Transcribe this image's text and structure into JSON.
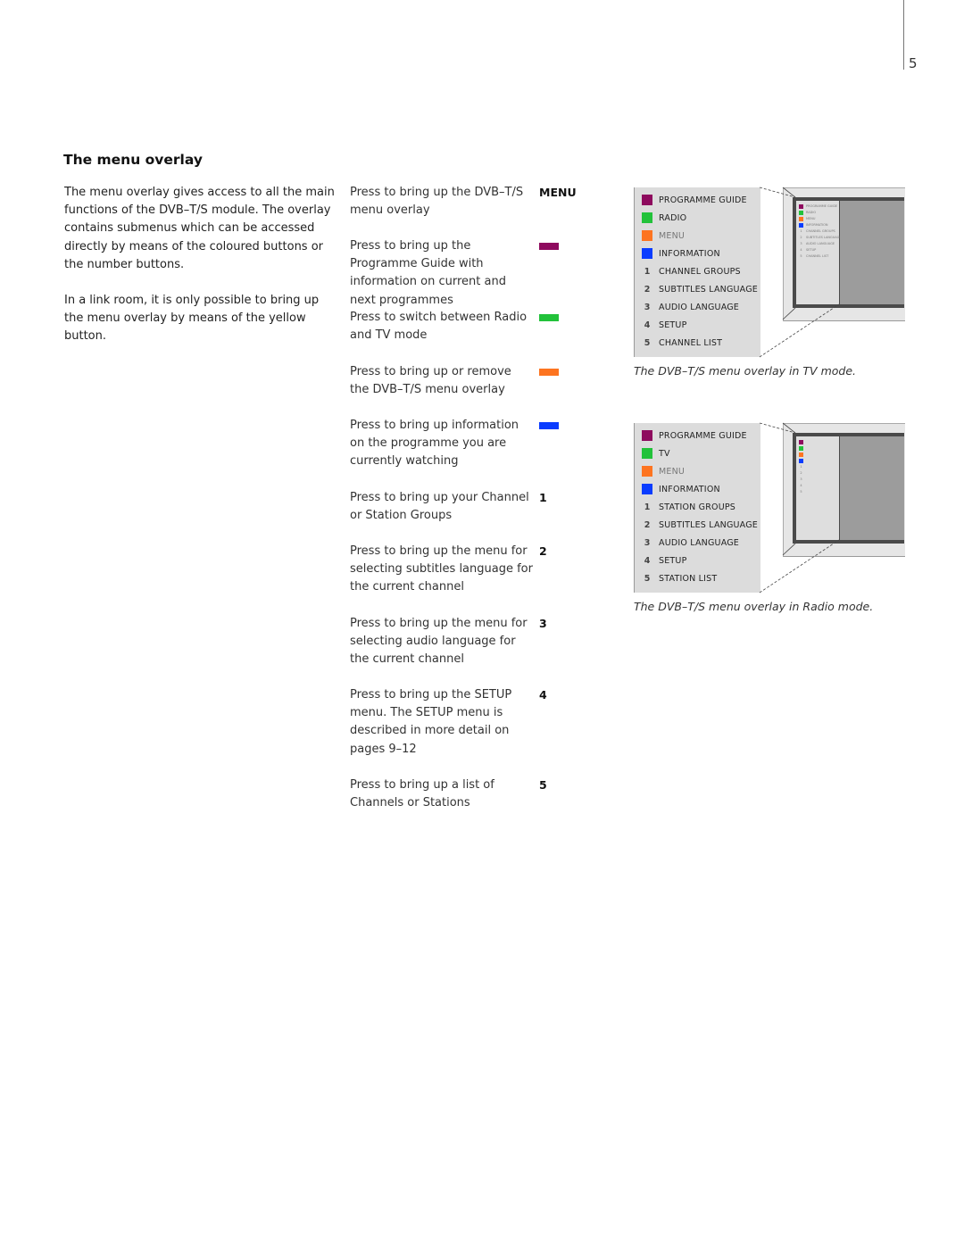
{
  "page": {
    "number": "5"
  },
  "section": {
    "title": "The menu overlay",
    "intro": [
      "The menu overlay gives access to all the main functions of the DVB–T/S module. The overlay contains submenus which can be accessed directly by means of the coloured buttons or the number buttons.",
      "In a link room, it is only possible to bring up the menu overlay by means of the yellow button."
    ]
  },
  "colors": {
    "purple": "#8e0a5e",
    "green": "#22c23a",
    "orange": "#fd7420",
    "blue": "#0a3cff"
  },
  "steps": [
    {
      "text": "Press to bring up the DVB–T/S menu overlay",
      "key": "MENU",
      "key_type": "text"
    },
    {
      "text": "Press to bring up the Programme Guide with information on current and next programmes",
      "key": "purple-button",
      "key_type": "color"
    },
    {
      "text": "Press to switch between Radio and TV mode",
      "key": "green-button",
      "key_type": "color"
    },
    {
      "text": "Press to bring up or remove the DVB–T/S menu overlay",
      "key": "orange-button",
      "key_type": "color"
    },
    {
      "text": "Press to bring up information on the programme you are currently watching",
      "key": "blue-button",
      "key_type": "color"
    },
    {
      "text": "Press to bring up your Channel or Station Groups",
      "key": "1",
      "key_type": "text"
    },
    {
      "text": "Press to bring up the menu for selecting subtitles language for the current channel",
      "key": "2",
      "key_type": "text"
    },
    {
      "text": "Press to bring up the menu for selecting audio language for the current channel",
      "key": "3",
      "key_type": "text"
    },
    {
      "text": "Press to bring up the SETUP menu. The SETUP menu is described in more detail on pages 9–12",
      "key": "4",
      "key_type": "text"
    },
    {
      "text": "Press to bring up a list of Channels or Stations",
      "key": "5",
      "key_type": "text"
    }
  ],
  "overlays": [
    {
      "caption": "The DVB–T/S menu overlay in TV mode.",
      "items": [
        {
          "marker": "purple",
          "label": "PROGRAMME GUIDE"
        },
        {
          "marker": "green",
          "label": "RADIO"
        },
        {
          "marker": "orange",
          "label": "MENU",
          "dim": true
        },
        {
          "marker": "blue",
          "label": "INFORMATION"
        },
        {
          "marker": "1",
          "label": "CHANNEL GROUPS"
        },
        {
          "marker": "2",
          "label": "SUBTITLES LANGUAGE"
        },
        {
          "marker": "3",
          "label": "AUDIO LANGUAGE"
        },
        {
          "marker": "4",
          "label": "SETUP"
        },
        {
          "marker": "5",
          "label": "CHANNEL LIST"
        }
      ],
      "mini_labels": true
    },
    {
      "caption": "The DVB–T/S menu overlay in Radio mode.",
      "items": [
        {
          "marker": "purple",
          "label": "PROGRAMME GUIDE"
        },
        {
          "marker": "green",
          "label": "TV"
        },
        {
          "marker": "orange",
          "label": "MENU",
          "dim": true
        },
        {
          "marker": "blue",
          "label": "INFORMATION"
        },
        {
          "marker": "1",
          "label": "STATION GROUPS"
        },
        {
          "marker": "2",
          "label": "SUBTITLES LANGUAGE"
        },
        {
          "marker": "3",
          "label": "AUDIO LANGUAGE"
        },
        {
          "marker": "4",
          "label": "SETUP"
        },
        {
          "marker": "5",
          "label": "STATION LIST"
        }
      ],
      "mini_labels": false
    }
  ]
}
